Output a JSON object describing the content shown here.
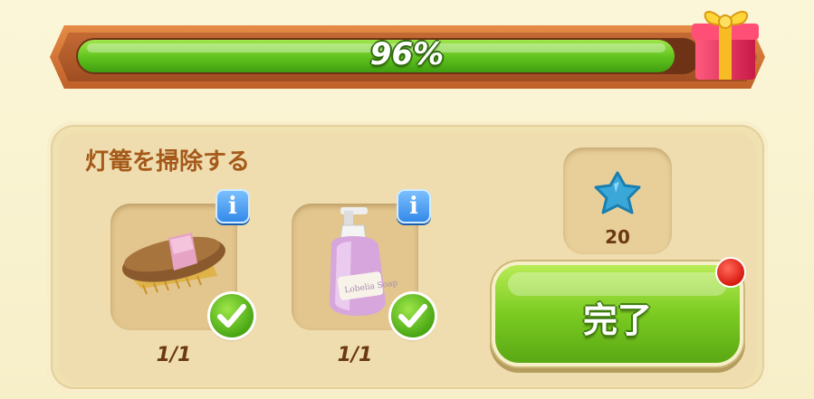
{
  "progress": {
    "percent_label": "96%",
    "fraction": 0.96,
    "reward_icon": "gift-box-icon"
  },
  "task": {
    "title": "灯篭を掃除する",
    "items": [
      {
        "icon": "brush-icon",
        "count": "1/1",
        "completed": true,
        "info_label": "i"
      },
      {
        "icon": "soap-bottle-icon",
        "count": "1/1",
        "completed": true,
        "info_label": "i"
      }
    ],
    "reward": {
      "icon": "blue-star-icon",
      "amount": "20"
    },
    "complete_button_label": "完了"
  },
  "colors": {
    "progress_green": "#5fc21d",
    "frame_orange": "#d2733a",
    "panel_bg": "#efddb0",
    "title_brown": "#a55a1a",
    "info_blue": "#2f86e8",
    "notify_red": "#d81a10"
  }
}
